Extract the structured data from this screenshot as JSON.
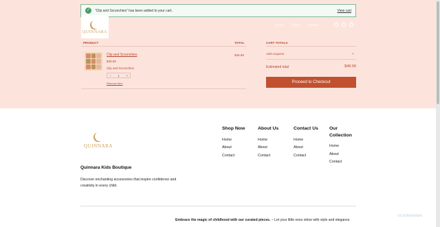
{
  "notice": {
    "message": "“Clip and Scrunchies” has been added to your cart.",
    "view_cart": "View cart"
  },
  "brand": {
    "logo_text": "QUINNARA",
    "accent": "#c9a15b"
  },
  "nav": {
    "items": [
      "Home",
      "About",
      "Contact"
    ]
  },
  "cart": {
    "headers": {
      "product": "PRODUCT",
      "total": "TOTAL",
      "cart_totals": "CART TOTALS"
    },
    "item": {
      "name": "Clip and Scrunchies",
      "price": "$49.99",
      "variant": "Clip and Scrunchies",
      "quantity": "1",
      "minus": "−",
      "plus": "+",
      "remove": "Remove item",
      "line_total": "$49.99"
    },
    "add_coupons": "Add coupons",
    "estimated_total_label": "Estimated total",
    "estimated_total": "$49.99",
    "checkout": "Proceed to Checkout",
    "button_color": "#c0502f"
  },
  "footer": {
    "brand_name": "Quinnara Kids Boutique",
    "description": "Discover enchanting accessories that inspire confidence and creativity in every child.",
    "columns": [
      {
        "title": "Shop Now",
        "links": [
          "Home",
          "About",
          "Contact"
        ]
      },
      {
        "title": "About Us",
        "links": [
          "Home",
          "About",
          "Contact"
        ]
      },
      {
        "title": "Contact Us",
        "links": [
          "Home",
          "About",
          "Contact"
        ]
      },
      {
        "title": "Our Collection",
        "links": [
          "Home",
          "About",
          "Contact"
        ]
      }
    ],
    "tagline_bold": "Embrace the magic of childhood with our curated pieces.",
    "tagline_rest": " – Let your little ones shine with style and elegance."
  },
  "watermark": "ScanMalware"
}
